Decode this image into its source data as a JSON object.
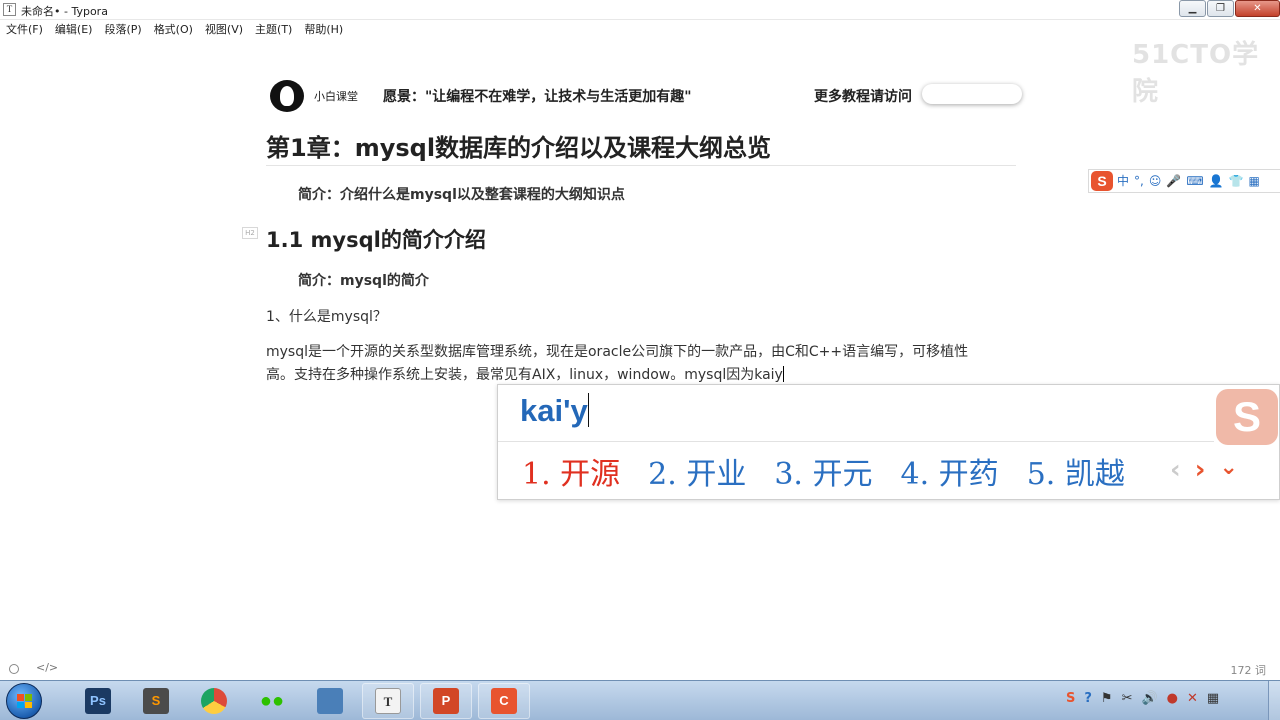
{
  "window": {
    "app_icon": "T",
    "title": "未命名• - Typora",
    "controls": {
      "minimize": "▁",
      "maximize": "❐",
      "close": "✕"
    }
  },
  "menu": [
    "文件(F)",
    "编辑(E)",
    "段落(P)",
    "格式(O)",
    "视图(V)",
    "主题(T)",
    "帮助(H)"
  ],
  "watermark": "51CTO学院",
  "banner": {
    "logo_text": "小白课堂",
    "motto": "愿景：\"让编程不在难学，让技术与生活更加有趣\"",
    "more": "更多教程请访问"
  },
  "document": {
    "h1": "第1章：mysql数据库的介绍以及课程大纲总览",
    "intro": "简介：介绍什么是mysql以及整套课程的大纲知识点",
    "h2_marker": "H2",
    "h2": "1.1 mysql的简介介绍",
    "intro2": "简介：mysql的简介",
    "q1": "1、什么是mysql？",
    "para_line1": "mysql是一个开源的关系型数据库管理系统，现在是oracle公司旗下的一款产品，由C和C++语言编写，可移植性",
    "para_line2": "高。支持在多种操作系统上安装，最常见有AIX，linux，window。mysql因为kaiy"
  },
  "ime_toolbar": {
    "logo": "S",
    "items": [
      {
        "icon": "chinese-mode",
        "glyph": "中"
      },
      {
        "icon": "punctuation",
        "glyph": "°,"
      },
      {
        "icon": "emoji",
        "glyph": "☺"
      },
      {
        "icon": "microphone",
        "glyph": "🎤"
      },
      {
        "icon": "keyboard",
        "glyph": "⌨"
      },
      {
        "icon": "user",
        "glyph": "👤"
      },
      {
        "icon": "skin",
        "glyph": "👕"
      },
      {
        "icon": "grid",
        "glyph": "▦"
      }
    ]
  },
  "ime": {
    "composition": "kai'y",
    "logo": "S",
    "candidates": [
      "1. 开源",
      "2. 开业",
      "3. 开元",
      "4. 开药",
      "5. 凯越"
    ],
    "nav": {
      "prev": "‹",
      "next": "›",
      "expand": "⌄"
    }
  },
  "statusbar": {
    "source_mode": "</>",
    "word_count": "172 词"
  },
  "taskbar": {
    "apps": [
      {
        "name": "photoshop",
        "label": "Ps",
        "color": "#1b3a63"
      },
      {
        "name": "sublime",
        "label": "S",
        "color": "#4b4b4b"
      },
      {
        "name": "chrome",
        "label": "",
        "color": "#dd4b39"
      },
      {
        "name": "wechat",
        "label": "",
        "color": "#2dc100"
      },
      {
        "name": "network",
        "label": "",
        "color": "#4a7fb8"
      },
      {
        "name": "typora",
        "label": "T",
        "color": "#f3f3f3"
      },
      {
        "name": "powerpoint",
        "label": "P",
        "color": "#d24726"
      },
      {
        "name": "recorder",
        "label": "C",
        "color": "#e8542f"
      }
    ],
    "tray": [
      {
        "icon": "sogou",
        "glyph": "S"
      },
      {
        "icon": "help",
        "glyph": "?"
      },
      {
        "icon": "flag",
        "glyph": "⚑"
      },
      {
        "icon": "scissors",
        "glyph": "✂"
      },
      {
        "icon": "volume",
        "glyph": "🔊"
      },
      {
        "icon": "record",
        "glyph": "●"
      },
      {
        "icon": "tray-close",
        "glyph": "✕"
      },
      {
        "icon": "grid",
        "glyph": "▦"
      }
    ]
  }
}
